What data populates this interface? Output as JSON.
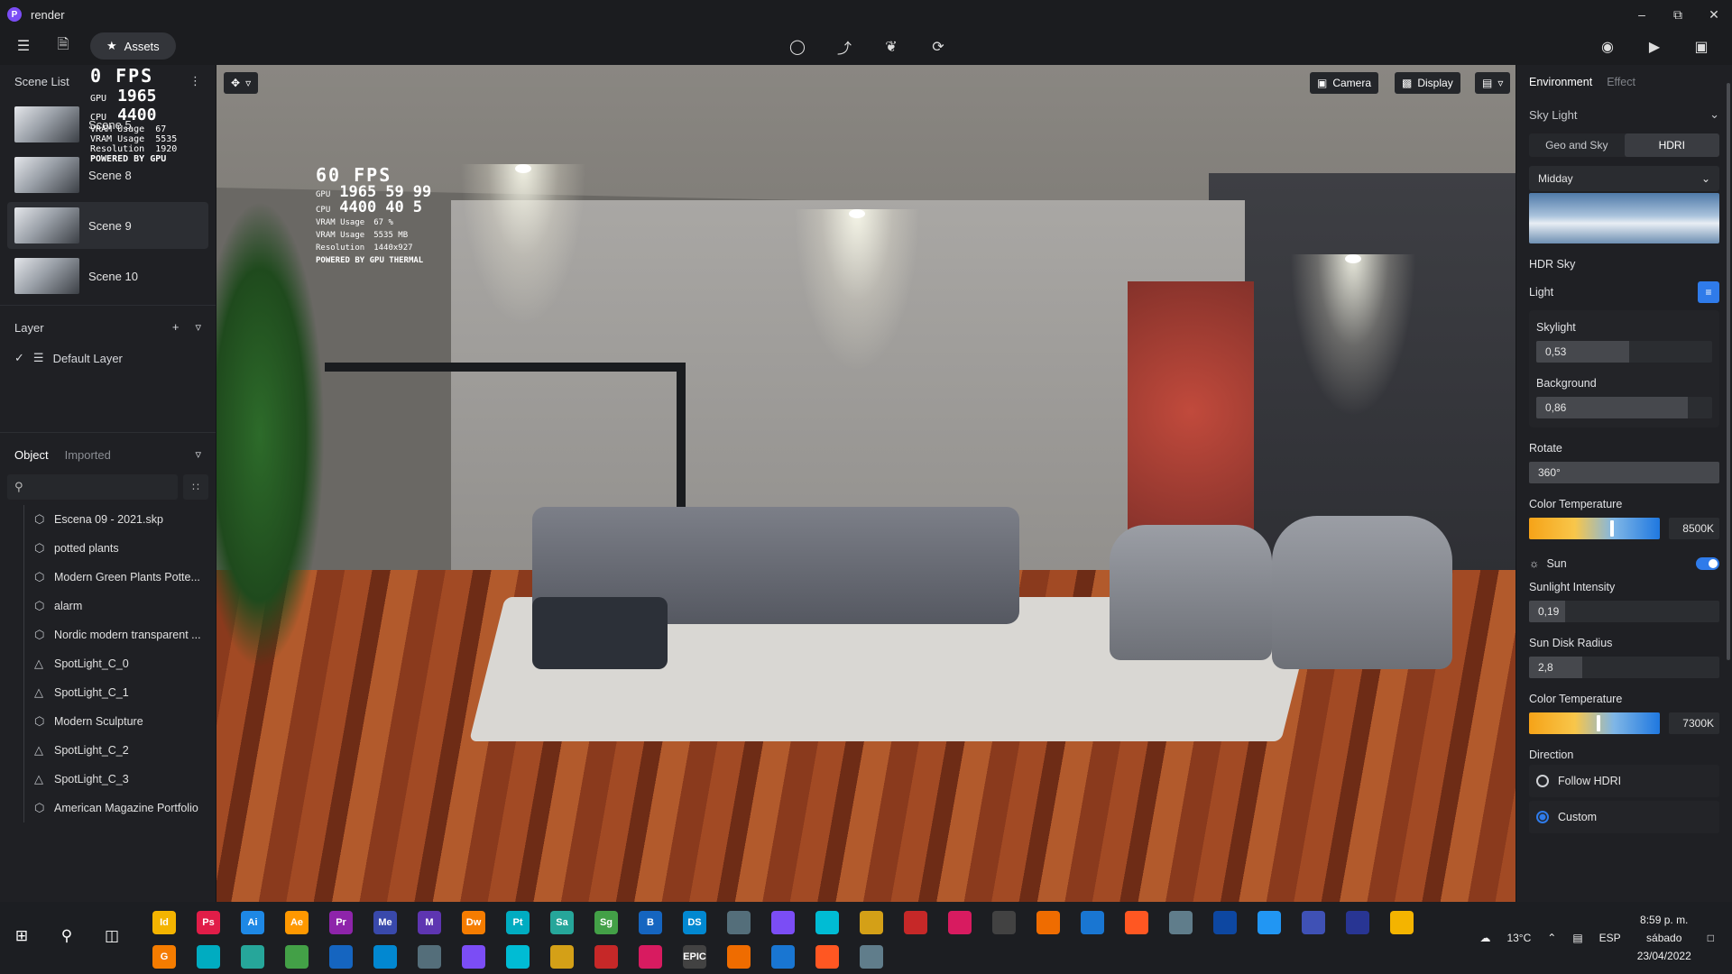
{
  "window": {
    "title": "render"
  },
  "toolbar": {
    "assets_label": "Assets"
  },
  "left": {
    "scene_list_title": "Scene List",
    "scenes": [
      {
        "label": "Scene 5"
      },
      {
        "label": "Scene 8"
      },
      {
        "label": "Scene 9"
      },
      {
        "label": "Scene 10"
      }
    ],
    "layer_title": "Layer",
    "layer_default": "Default Layer",
    "tabs": {
      "object": "Object",
      "imported": "Imported"
    },
    "objects": [
      {
        "label": "Escena 09 - 2021.skp",
        "icon": "cube-icon"
      },
      {
        "label": "potted plants",
        "icon": "cube-icon"
      },
      {
        "label": "Modern Green Plants Potte...",
        "icon": "cube-icon"
      },
      {
        "label": "alarm",
        "icon": "cube-icon"
      },
      {
        "label": "Nordic modern transparent ...",
        "icon": "cube-icon"
      },
      {
        "label": "SpotLight_C_0",
        "icon": "cone-icon"
      },
      {
        "label": "SpotLight_C_1",
        "icon": "cone-icon"
      },
      {
        "label": "Modern Sculpture",
        "icon": "cube-icon"
      },
      {
        "label": "SpotLight_C_2",
        "icon": "cone-icon"
      },
      {
        "label": "SpotLight_C_3",
        "icon": "cone-icon"
      },
      {
        "label": "American Magazine Portfolio",
        "icon": "cube-icon"
      }
    ]
  },
  "overlay_left": {
    "fps": "0 FPS",
    "gpu_label": "GPU",
    "gpu_mhz": "1965",
    "cpu_label": "CPU",
    "cpu_mhz": "4400",
    "vram_label": "VRAM Usage",
    "vram_val1": "67",
    "vram_label2": "VRAM Usage",
    "vram_val2": "5535",
    "res_label": "Resolution",
    "res_val": "1920",
    "powered": "POWERED BY GPU"
  },
  "overlay_vp": {
    "fps": "60 FPS",
    "gpu_label": "GPU",
    "gpu_mhz": "1965",
    "gpu_temp": "59",
    "gpu_load": "99",
    "cpu_label": "CPU",
    "cpu_mhz": "4400",
    "cpu_temp": "40",
    "cpu_load": "5",
    "vram_label": "VRAM Usage",
    "vram_val1": "67 %",
    "vram_label2": "VRAM Usage",
    "vram_val2": "5535 MB",
    "res_label": "Resolution",
    "res_val": "1440x927",
    "powered": "POWERED BY GPU THERMAL"
  },
  "viewport": {
    "camera_label": "Camera",
    "display_label": "Display"
  },
  "right": {
    "tab_environment": "Environment",
    "tab_effect": "Effect",
    "sky_light": "Sky Light",
    "seg_geo": "Geo and Sky",
    "seg_hdri": "HDRI",
    "preset": "Midday",
    "hdr_sky": "HDR Sky",
    "light": "Light",
    "skylight_label": "Skylight",
    "skylight_val": "0,53",
    "skylight_pct": 0.53,
    "background_label": "Background",
    "background_val": "0,86",
    "background_pct": 0.86,
    "rotate_label": "Rotate",
    "rotate_val": "360°",
    "color_temp_label": "Color Temperature",
    "color_temp_val": "8500K",
    "sun_label": "Sun",
    "sunlight_label": "Sunlight Intensity",
    "sunlight_val": "0,19",
    "sunlight_pct": 0.19,
    "sundisk_label": "Sun Disk Radius",
    "sundisk_val": "2,8",
    "sundisk_pct": 0.28,
    "sun_temp_label": "Color Temperature",
    "sun_temp_val": "7300K",
    "direction_label": "Direction",
    "follow_hdri": "Follow HDRI",
    "custom": "Custom"
  },
  "taskbar": {
    "weather": "13°C",
    "lang": "ESP",
    "time": "8:59 p. m.",
    "day": "sábado",
    "date": "23/04/2022",
    "apps_row1": [
      "Id",
      "Ps",
      "Ai",
      "Ae",
      "Pr",
      "Me",
      "M",
      "Dw",
      "Pt",
      "Sa",
      "Sg",
      "B",
      "DS"
    ],
    "apps_row2": [
      "G",
      "EPIC"
    ]
  },
  "colors": {
    "accent": "#2f7bea",
    "brand": "#7b4df5",
    "panel": "#1f2024"
  }
}
